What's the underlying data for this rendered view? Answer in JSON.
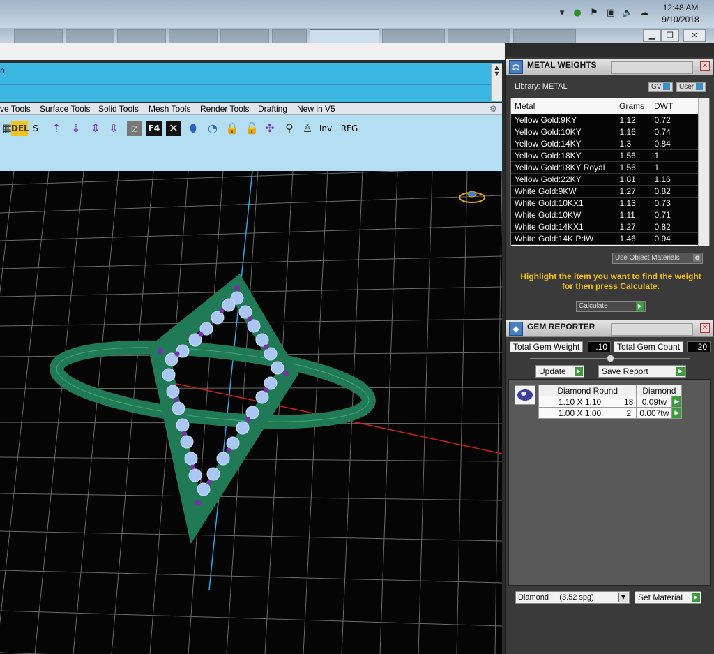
{
  "taskbar": {
    "time": "12:48 AM",
    "date": "9/10/2018",
    "tray_icons": [
      "chevron-up-icon",
      "security-shield-icon",
      "flag-icon",
      "network-icon",
      "volume-icon",
      "cloud-icon"
    ]
  },
  "window": {
    "controls": [
      "minimize-icon",
      "restore-icon",
      "close-icon"
    ]
  },
  "command": {
    "prompt_fragment": "n"
  },
  "tool_tabs": [
    "ve Tools",
    "Surface Tools",
    "Solid Tools",
    "Mesh Tools",
    "Render Tools",
    "Drafting",
    "New in V5"
  ],
  "toolbar": {
    "del_label": "DEL",
    "s_label": "S",
    "f4_label": "F4",
    "inv_label": "Inv",
    "rfg_label": "RFG"
  },
  "metal_weights": {
    "title": "METAL WEIGHTS",
    "library_label": "Library: METAL",
    "gv_label": "GV",
    "user_label": "User",
    "columns": [
      "Metal",
      "Grams",
      "DWT"
    ],
    "rows": [
      [
        "Yellow Gold:9KY",
        "1.12",
        "0.72"
      ],
      [
        "Yellow Gold:10KY",
        "1.16",
        "0.74"
      ],
      [
        "Yellow Gold:14KY",
        "1.3",
        "0.84"
      ],
      [
        "Yellow Gold:18KY",
        "1.56",
        "1"
      ],
      [
        "Yellow Gold:18KY Royal",
        "1.56",
        "1"
      ],
      [
        "Yellow Gold:22KY",
        "1.81",
        "1.16"
      ],
      [
        "White Gold:9KW",
        "1.27",
        "0.82"
      ],
      [
        "White Gold:10KX1",
        "1.13",
        "0.73"
      ],
      [
        "White Gold:10KW",
        "1.11",
        "0.71"
      ],
      [
        "White Gold:14KX1",
        "1.27",
        "0.82"
      ],
      [
        "White Gold:14K PdW",
        "1.46",
        "0.94"
      ]
    ],
    "use_object_materials": "Use Object Materials",
    "hint": "Highlight the item you want to find the weight for then press Calculate.",
    "calculate_label": "Calculate"
  },
  "gem_reporter": {
    "title": "GEM REPORTER",
    "total_weight_label": "Total Gem Weight",
    "total_weight_value": ".10",
    "total_count_label": "Total Gem Count",
    "total_count_value": "20",
    "update_label": "Update",
    "save_report_label": "Save Report",
    "header": [
      "Diamond Round",
      "Diamond"
    ],
    "rows": [
      [
        "1.10 X 1.10",
        "18",
        "0.09tw"
      ],
      [
        "1.00 X 1.00",
        "2",
        "0.007tw"
      ]
    ],
    "material_select": "Diamond     (3.52 spg)",
    "set_material_label": "Set Material"
  },
  "colors": {
    "command_bg": "#3cb7e2",
    "hint_text": "#f3c21d",
    "ring": "#1f7a55",
    "gem": "#a9c7f2",
    "prong": "#7a2fb0"
  }
}
